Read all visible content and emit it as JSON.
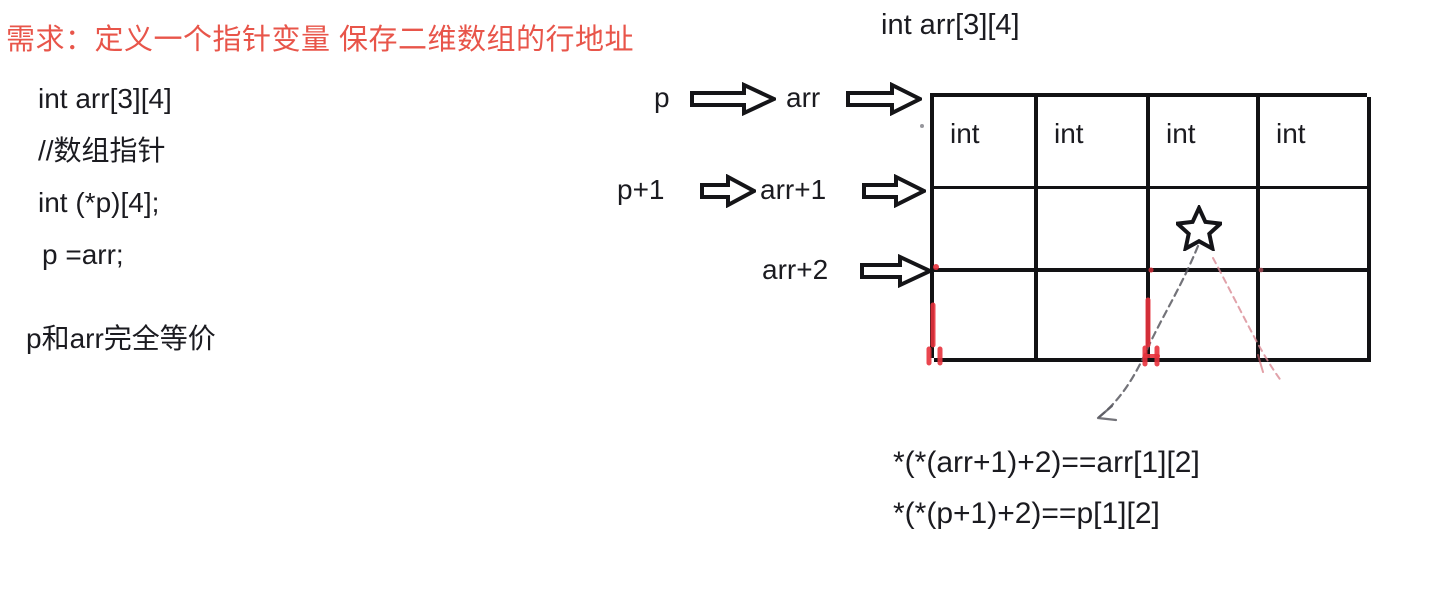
{
  "slide": {
    "background_color": "#ffffff",
    "title": {
      "text": "需求：定义一个指针变量 保存二维数组的行地址",
      "color": "#e8554a"
    }
  },
  "code_block": {
    "lines": [
      "int arr[3][4]",
      "//数组指针",
      "int (*p)[4];",
      "p =arr;"
    ],
    "note": "p和arr完全等价"
  },
  "diagram": {
    "array_declaration": "int arr[3][4]",
    "pointer_rows": [
      {
        "pointer_label": "p",
        "array_label": "arr",
        "arrow_1": "double-arrow-right-icon",
        "arrow_2": "double-arrow-right-icon"
      },
      {
        "pointer_label": "p+1",
        "array_label": "arr+1",
        "arrow_1": "double-arrow-right-icon",
        "arrow_2": "double-arrow-right-icon"
      },
      {
        "pointer_label": "",
        "array_label": "arr+2",
        "arrow_1": "",
        "arrow_2": "double-arrow-right-icon"
      }
    ],
    "grid": {
      "rows": 3,
      "columns": 4,
      "cells": [
        [
          "int",
          "int",
          "int",
          "int"
        ],
        [
          "",
          "",
          "",
          ""
        ],
        [
          "",
          "",
          "",
          ""
        ]
      ],
      "border_color": "#121214",
      "marker": {
        "icon": "star-outline-icon",
        "row": 2,
        "column": 3
      }
    },
    "ink_annotation": {
      "curve_color": "#4a4a52",
      "red_ink_color": "#e8323c"
    }
  },
  "formulas": [
    "*(*(arr+1)+2)==arr[1][2]",
    "*(*(p+1)+2)==p[1][2]"
  ]
}
